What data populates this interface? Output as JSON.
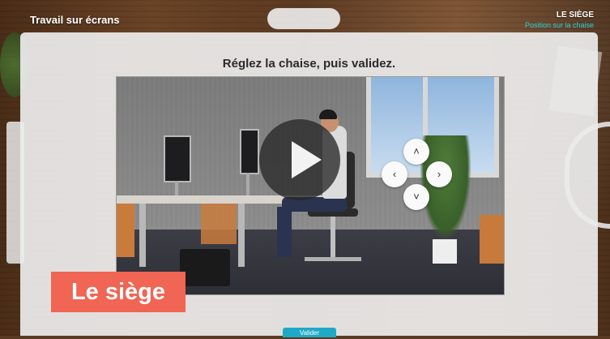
{
  "app": {
    "title": "Travail sur écrans"
  },
  "section": {
    "title": "LE SIÈGE",
    "subtitle": "Position sur la chaise"
  },
  "instruction": "Réglez la chaise, puis validez.",
  "video": {
    "play_icon": "play-icon"
  },
  "controls": {
    "up": "˄",
    "down": "˅",
    "left": "‹",
    "right": "›"
  },
  "badge": {
    "label": "Le siège"
  },
  "validate": {
    "label": "Valider"
  },
  "colors": {
    "accent": "#1fa9c7",
    "subtitle": "#2ad0d8",
    "badge": "#f06553"
  }
}
